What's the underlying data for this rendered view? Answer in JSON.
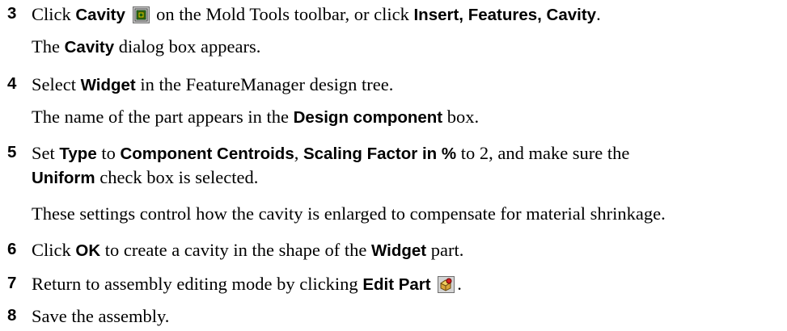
{
  "steps": [
    {
      "number": "3",
      "t1": "Click ",
      "b1": "Cavity",
      "icon": "cavity-icon",
      "t2": " on the Mold Tools toolbar, or click ",
      "b2": "Insert, Features, Cavity",
      "t3": "."
    },
    {
      "t1": "The ",
      "b1": "Cavity",
      "t2": " dialog box appears."
    },
    {
      "number": "4",
      "t1": "Select ",
      "b1": "Widget",
      "t2": " in the FeatureManager design tree."
    },
    {
      "t1": "The name of the part appears in the ",
      "b1": "Design component",
      "t2": " box."
    },
    {
      "number": "5",
      "t1": "Set ",
      "b1": "Type",
      "t2": " to ",
      "b2": "Component Centroids",
      "t3": ", ",
      "b3": "Scaling Factor in %",
      "t4": " to 2, and make sure the"
    },
    {
      "b1": "Uniform",
      "t1": " check box is selected."
    },
    {
      "t1": "These settings control how the cavity is enlarged to compensate for material shrinkage."
    },
    {
      "number": "6",
      "t1": "Click ",
      "b1": "OK",
      "t2": " to create a cavity in the shape of the ",
      "b2": "Widget",
      "t3": " part."
    },
    {
      "number": "7",
      "t1": "Return to assembly editing mode by clicking ",
      "b1": "Edit Part",
      "icon": "edit-part-icon",
      "t2": "."
    },
    {
      "number": "8",
      "t1": "Save the assembly."
    }
  ]
}
